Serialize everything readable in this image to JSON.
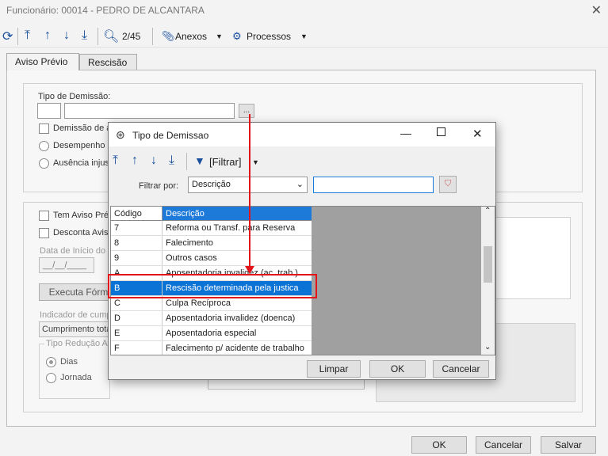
{
  "window": {
    "title": "Funcionário: 00014 - PEDRO DE ALCANTARA",
    "close": "✕"
  },
  "toolbar": {
    "counter": "2/45",
    "anexos": "Anexos",
    "processos": "Processos"
  },
  "tabs": [
    {
      "label": "Aviso Prévio"
    },
    {
      "label": "Rescisão"
    }
  ],
  "form": {
    "tipo_label": "Tipo de Demissão:",
    "dots_label": "...",
    "demissao_label": "Demissão de a",
    "desempenho": "Desempenho in",
    "ausencia": "Ausência injust",
    "tem_aviso": "Tem Aviso Prév",
    "desconta_aviso": "Desconta Aviso",
    "data_inicio": "Data de Início do",
    "date_placeholder": "__/__/____",
    "executa": "Executa Fórm",
    "indicador": "Indicador de cump",
    "cumprimento": "Cumprimento tota",
    "tipo_reducao": "Tipo Redução Av",
    "dias": "Dias",
    "jornada": "Jornada"
  },
  "dialog": {
    "title": "Tipo de Demissao",
    "filtrar": "[Filtrar]",
    "filtrar_por_label": "Filtrar por:",
    "filtrar_por_value": "Descrição",
    "search_value": "",
    "columns": {
      "codigo": "Código",
      "descricao": "Descrição"
    },
    "rows": [
      {
        "codigo": "7",
        "descricao": "Reforma ou Transf. para Reserva"
      },
      {
        "codigo": "8",
        "descricao": "Falecimento"
      },
      {
        "codigo": "9",
        "descricao": "Outros casos"
      },
      {
        "codigo": "A",
        "descricao": "Aposentadoria invalidez (ac. trab.)"
      },
      {
        "codigo": "B",
        "descricao": "Rescisão determinada pela justica",
        "selected": true
      },
      {
        "codigo": "C",
        "descricao": "Culpa Recíproca"
      },
      {
        "codigo": "D",
        "descricao": "Aposentadoria invalidez (doenca)"
      },
      {
        "codigo": "E",
        "descricao": "Aposentadoria especial"
      },
      {
        "codigo": "F",
        "descricao": "Falecimento p/ acidente de trabalho"
      }
    ],
    "buttons": {
      "limpar": "Limpar",
      "ok": "OK",
      "cancelar": "Cancelar"
    }
  },
  "footer": {
    "ok": "OK",
    "cancelar": "Cancelar",
    "salvar": "Salvar"
  },
  "colors": {
    "accent": "#1e7ad8",
    "selection": "#0b72d6",
    "annotation": "#e4141b"
  }
}
